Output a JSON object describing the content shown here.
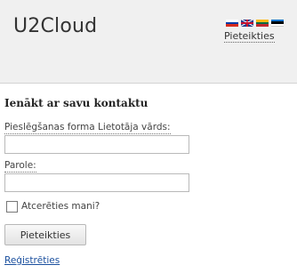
{
  "header": {
    "brand": "U2Cloud",
    "login_link": "Pieteikties",
    "languages": [
      {
        "name": "russian-flag-icon"
      },
      {
        "name": "english-flag-icon"
      },
      {
        "name": "lithuanian-flag-icon"
      },
      {
        "name": "estonian-flag-icon"
      }
    ]
  },
  "form": {
    "title": "Ienākt ar savu kontaktu",
    "username_label": "Pieslēgšanas forma Lietotāja vārds:",
    "username_value": "",
    "password_label": "Parole:",
    "password_value": "",
    "remember_label": "Atcerēties mani?",
    "remember_checked": false,
    "submit_label": "Pieteikties",
    "register_link": "Reģistrēties"
  },
  "colors": {
    "header_bg": "#f0f0f0",
    "link": "#1a4f9e"
  }
}
